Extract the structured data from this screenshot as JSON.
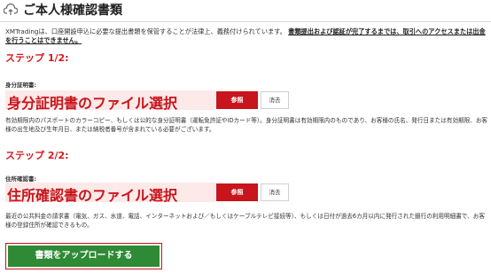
{
  "header": {
    "title": "ご本人様確認書類"
  },
  "notice": {
    "text": "XMTradingは、口座開設申込に必要な提出書類を保管することが法律上、義務付けられています。",
    "link_text": "書類提出および認証が完了するまでは、取引へのアクセスまたは出金を行うことはできません。"
  },
  "step1": {
    "heading": "ステップ 1/2:",
    "field_label": "身分証明書:",
    "file_placeholder": "身分証明書のファイル選択",
    "browse_label": "参照",
    "remove_label": "消去",
    "description": "有効期限内のパスポートのカラーコピー、もしくは公的な身分証明書（運転免許証やIDカード等）。身分証明書は有効期限内のものであり、お客様の氏名、発行日または有効期限、お客様の出生地及び生年月日、または納税者番号が含まれている必要がございます。"
  },
  "step2": {
    "heading": "ステップ 2/2:",
    "field_label": "住所確認書:",
    "file_placeholder": "住所確認書のファイル選択",
    "browse_label": "参照",
    "remove_label": "消去",
    "description": "最近の公共料金の請求書（電気、ガス、水道、電話、インターネットおよび／もしくはケーブルテレビ接続等）、もしくは日付が過去6カ月以内に発行された銀行の利用明細書で、お客様の登録住所が確認できるもの。"
  },
  "upload": {
    "label": "書類をアップロードする"
  },
  "colors": {
    "accent_red": "#c8141c",
    "upload_green": "#2f8a35",
    "file_box_bg": "#fce9e8"
  },
  "icons": {
    "header": "cloud-upload-icon"
  }
}
